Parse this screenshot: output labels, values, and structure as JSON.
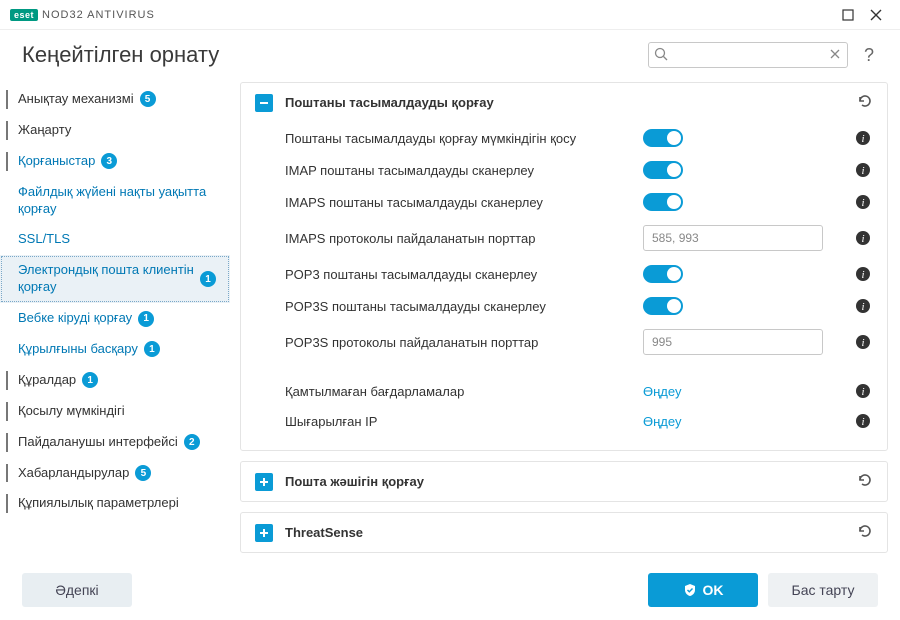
{
  "app": {
    "brand": "eset",
    "product": "NOD32 ANTIVIRUS"
  },
  "header": {
    "title": "Кеңейтілген орнату",
    "search_placeholder": ""
  },
  "sidebar": {
    "items": [
      {
        "label": "Анықтау механизмі",
        "badge": "5",
        "type": "top"
      },
      {
        "label": "Жаңарту",
        "type": "top"
      },
      {
        "label": "Қорғаныстар",
        "badge": "3",
        "type": "top",
        "expanded": true
      },
      {
        "label": "Файлдық жүйені нақты уақытта қорғау",
        "type": "sub"
      },
      {
        "label": "SSL/TLS",
        "type": "sub"
      },
      {
        "label": "Электрондық пошта клиентін қорғау",
        "badge": "1",
        "type": "sub",
        "selected": true
      },
      {
        "label": "Вебке кіруді қорғау",
        "badge": "1",
        "type": "sub"
      },
      {
        "label": "Құрылғыны басқару",
        "badge": "1",
        "type": "sub"
      },
      {
        "label": "Құралдар",
        "badge": "1",
        "type": "top"
      },
      {
        "label": "Қосылу мүмкіндігі",
        "type": "top"
      },
      {
        "label": "Пайдаланушы интерфейсі",
        "badge": "2",
        "type": "top"
      },
      {
        "label": "Хабарландырулар",
        "badge": "5",
        "type": "top"
      },
      {
        "label": "Құпиялылық параметрлері",
        "type": "top"
      }
    ]
  },
  "panels": [
    {
      "title": "Поштаны тасымалдауды қорғау",
      "expanded": true,
      "rows": [
        {
          "label": "Поштаны тасымалдауды қорғау мүмкіндігін қосу",
          "type": "toggle",
          "value": true
        },
        {
          "label": "IMAP поштаны тасымалдауды сканерлеу",
          "type": "toggle",
          "value": true
        },
        {
          "label": "IMAPS поштаны тасымалдауды сканерлеу",
          "type": "toggle",
          "value": true
        },
        {
          "label": "IMAPS протоколы пайдаланатын порттар",
          "type": "text",
          "value": "585, 993"
        },
        {
          "label": "POP3 поштаны тасымалдауды сканерлеу",
          "type": "toggle",
          "value": true
        },
        {
          "label": "POP3S поштаны тасымалдауды сканерлеу",
          "type": "toggle",
          "value": true
        },
        {
          "label": "POP3S протоколы пайдаланатын порттар",
          "type": "text",
          "value": "995"
        },
        {
          "type": "gap"
        },
        {
          "label": "Қамтылмаған бағдарламалар",
          "type": "link",
          "value": "Өңдеу"
        },
        {
          "label": "Шығарылған IP",
          "type": "link",
          "value": "Өңдеу"
        }
      ]
    },
    {
      "title": "Пошта жәшігін қорғау",
      "expanded": false
    },
    {
      "title": "ThreatSense",
      "expanded": false
    }
  ],
  "footer": {
    "default": "Әдепкі",
    "ok": "OK",
    "cancel": "Бас тарту"
  }
}
